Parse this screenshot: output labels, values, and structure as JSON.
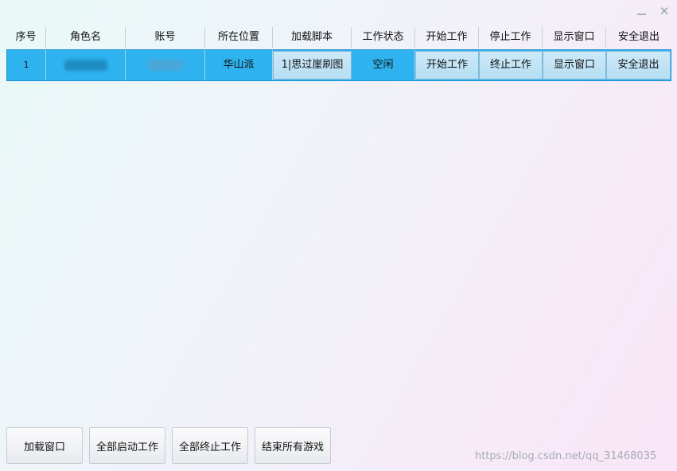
{
  "window": {
    "minimize_label": "—",
    "close_label": "✕"
  },
  "table": {
    "columns": [
      "序号",
      "角色名",
      "账号",
      "所在位置",
      "加载脚本",
      "工作状态",
      "开始工作",
      "停止工作",
      "显示窗口",
      "安全退出"
    ],
    "rows": [
      {
        "index": "1",
        "role_name": "",
        "account": "",
        "location": "华山派",
        "script": "1|思过崖刷图",
        "status": "空闲",
        "start": "开始工作",
        "stop": "终止工作",
        "show": "显示窗口",
        "exit": "安全退出"
      }
    ]
  },
  "footer": {
    "buttons": [
      "加载窗口",
      "全部启动工作",
      "全部终止工作",
      "结束所有游戏"
    ]
  },
  "watermark": "https://blog.csdn.net/qq_31468035"
}
